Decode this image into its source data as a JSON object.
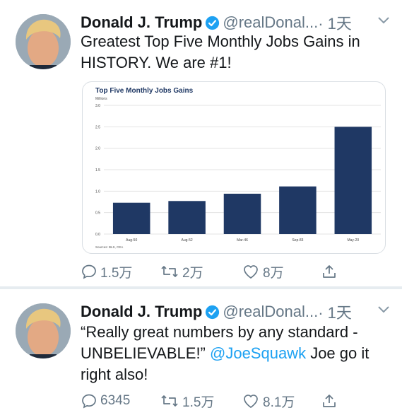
{
  "tweets": [
    {
      "name": "Donald J. Trump",
      "handle": "@realDonal...",
      "time": "· 1天",
      "text": "Greatest Top Five Monthly Jobs Gains in HISTORY. We are #1!",
      "replies": "1.5万",
      "retweets": "2万",
      "likes": "8万"
    },
    {
      "name": "Donald J. Trump",
      "handle": "@realDonal...",
      "time": "· 1天",
      "text_before": "“Really great numbers by any standard - UNBELIEVABLE!” ",
      "mention": "@JoeSquawk",
      "text_after": " Joe go it right also!",
      "replies": "6345",
      "retweets": "1.5万",
      "likes": "8.1万"
    }
  ],
  "icons": [
    "verified-badge-icon",
    "chevron-down-icon",
    "reply-icon",
    "retweet-icon",
    "like-icon",
    "share-icon"
  ],
  "colors": {
    "accent": "#1da1f2",
    "bar": "#1f3864",
    "muted": "#657786"
  },
  "chart_data": {
    "type": "bar",
    "title": "Top Five Monthly Jobs Gains",
    "ylabel": "Millions",
    "source": "Sources: BLS, CEA",
    "categories": [
      "Aug-50",
      "Aug-52",
      "Mar-46",
      "Sep-83",
      "May-20"
    ],
    "values": [
      0.73,
      0.77,
      0.94,
      1.11,
      2.5
    ],
    "ylim": [
      0,
      3.0
    ],
    "yticks": [
      "0.0",
      "0.5",
      "1.0",
      "1.5",
      "2.0",
      "2.5",
      "3.0"
    ],
    "grid": true
  }
}
